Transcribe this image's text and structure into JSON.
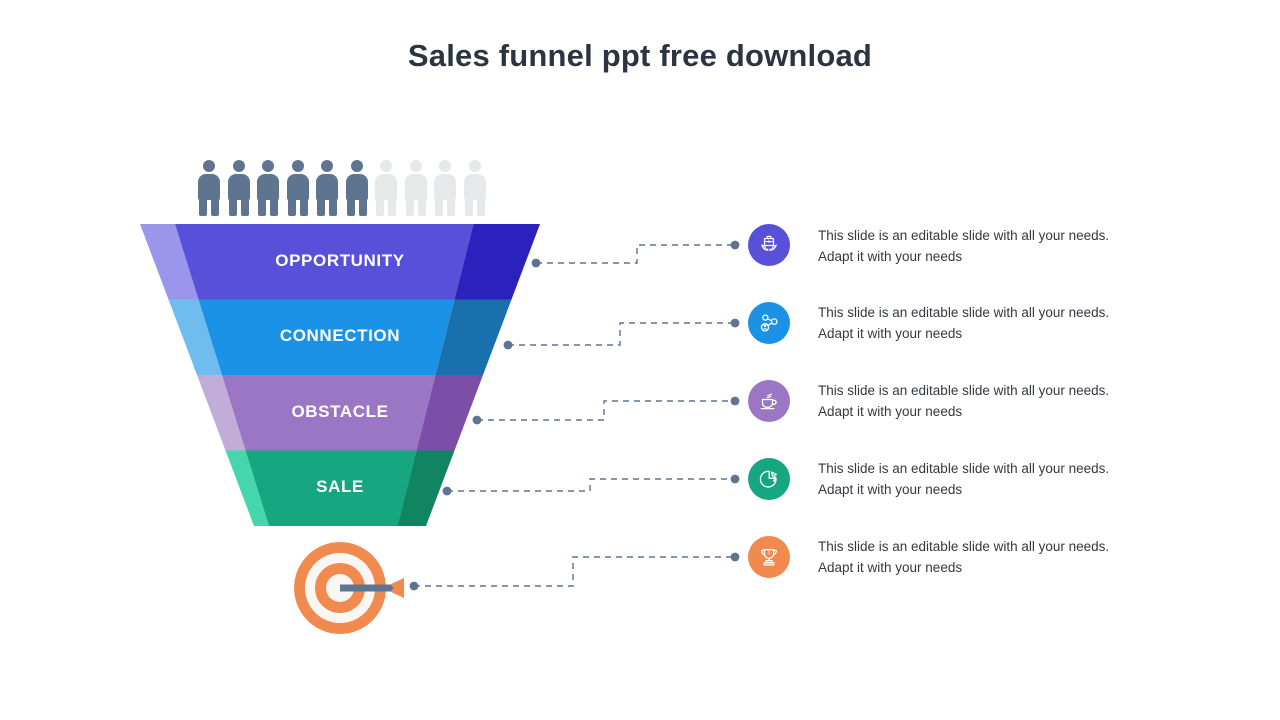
{
  "slide": {
    "title": "Sales funnel ppt free download",
    "background_color": "#ffffff",
    "title_color": "#2b3440"
  },
  "people": {
    "total": 10,
    "filled_count": 6,
    "filled_color": "#5e7491",
    "empty_color": "#e6e8ea",
    "icon_name": "person-icon"
  },
  "funnel": {
    "stages": [
      {
        "label": "OPPORTUNITY",
        "light_color": "#9b95ec",
        "main_color": "#5850d8",
        "dark_color": "#2b21bc"
      },
      {
        "label": "CONNECTION",
        "light_color": "#6fbcef",
        "main_color": "#1b92e5",
        "dark_color": "#1a6fad"
      },
      {
        "label": "OBSTACLE",
        "light_color": "#c2acd8",
        "main_color": "#9b76c4",
        "dark_color": "#7b4fa8"
      },
      {
        "label": "SALE",
        "light_color": "#45d6ab",
        "main_color": "#16a680",
        "dark_color": "#118562"
      }
    ]
  },
  "target": {
    "icon_name": "bullseye-target-icon",
    "ring_color": "#f08a4e",
    "gap_color": "#faf7f3",
    "arrow_shaft_color": "#5e7491",
    "arrow_fletch_color": "#f08a4e"
  },
  "connectors": {
    "line_color": "#5e7491",
    "dot_color": "#5e7491",
    "style": "dashed"
  },
  "items": [
    {
      "icon_name": "briefcase-laurel-icon",
      "icon_bg": "#5850d8",
      "text": "This slide is an editable slide with all your needs. Adapt it with your needs"
    },
    {
      "icon_name": "network-share-icon",
      "icon_bg": "#1b92e5",
      "text": "This slide is an editable slide with all your needs. Adapt it with your needs"
    },
    {
      "icon_name": "coffee-cup-icon",
      "icon_bg": "#9b76c4",
      "text": "This slide is an editable slide with all your needs. Adapt it with your needs"
    },
    {
      "icon_name": "pie-chart-dollar-icon",
      "icon_bg": "#16a680",
      "text": "This slide is an editable slide with all your needs. Adapt it with your needs"
    },
    {
      "icon_name": "trophy-icon",
      "icon_bg": "#f08a4e",
      "text": "This slide is an editable slide with all your needs. Adapt it with your needs"
    }
  ]
}
